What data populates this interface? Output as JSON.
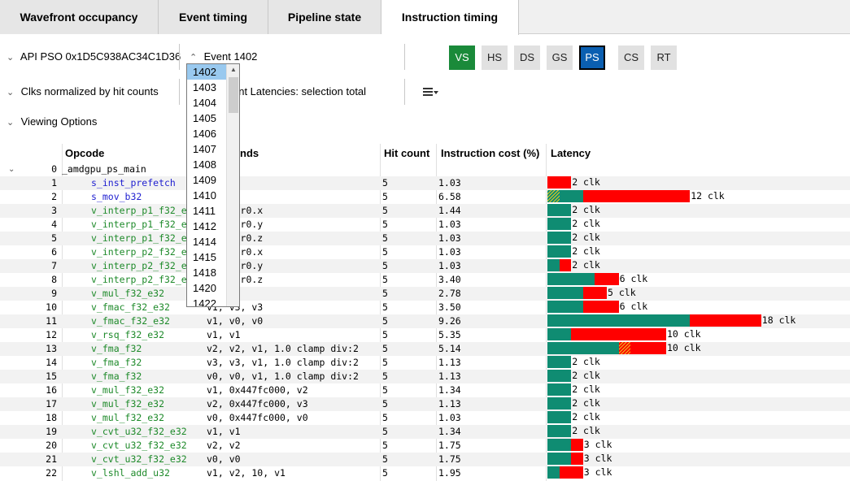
{
  "tabs": [
    {
      "label": "Wavefront occupancy",
      "active": false
    },
    {
      "label": "Event timing",
      "active": false
    },
    {
      "label": "Pipeline state",
      "active": false
    },
    {
      "label": "Instruction timing",
      "active": true
    }
  ],
  "toolbar": {
    "api_pso": "API PSO 0x1D5C938AC34C1D36",
    "event": "Event 1402",
    "clks_mode": "Clks normalized by hit counts",
    "latency_mode": "ont Latencies: selection total",
    "viewing_options": "Viewing Options",
    "stages": [
      "VS",
      "HS",
      "DS",
      "GS",
      "PS",
      "CS",
      "RT"
    ],
    "active_stages": [
      "VS",
      "PS"
    ]
  },
  "event_dropdown": {
    "selected": "1402",
    "options": [
      "1402",
      "1403",
      "1404",
      "1405",
      "1406",
      "1407",
      "1408",
      "1409",
      "1410",
      "1411",
      "1412",
      "1414",
      "1415",
      "1418",
      "1420",
      "1422"
    ]
  },
  "table": {
    "headers": {
      "opcode": "Opcode",
      "operands": "nds",
      "hit_count": "Hit count",
      "cost": "Instruction cost (%)",
      "latency": "Latency"
    },
    "function_index": "0",
    "function_name": "_amdgpu_ps_main",
    "rows": [
      {
        "idx": "1",
        "op": "s_inst_prefetch",
        "opnd": "",
        "hit": "5",
        "cost": "1.03",
        "total": 2,
        "teal": 0,
        "hatch": 0,
        "clk": "2 clk",
        "blue": true
      },
      {
        "idx": "2",
        "op": "s_mov_b32",
        "opnd": "25",
        "hit": "5",
        "cost": "6.58",
        "total": 12,
        "teal": 3,
        "hatch": 1,
        "clk": "12 clk",
        "blue": true
      },
      {
        "idx": "3",
        "op": "v_interp_p1_f32_e",
        "opnd": "), attr0.x",
        "hit": "5",
        "cost": "1.44",
        "total": 2,
        "teal": 2,
        "hatch": 0,
        "clk": "2 clk"
      },
      {
        "idx": "4",
        "op": "v_interp_p1_f32_e",
        "opnd": "), attr0.y",
        "hit": "5",
        "cost": "1.03",
        "total": 2,
        "teal": 2,
        "hatch": 0,
        "clk": "2 clk"
      },
      {
        "idx": "5",
        "op": "v_interp_p1_f32_e",
        "opnd": "), attr0.z",
        "hit": "5",
        "cost": "1.03",
        "total": 2,
        "teal": 2,
        "hatch": 0,
        "clk": "2 clk"
      },
      {
        "idx": "6",
        "op": "v_interp_p2_f32_e",
        "opnd": "., attr0.x",
        "hit": "5",
        "cost": "1.03",
        "total": 2,
        "teal": 2,
        "hatch": 0,
        "clk": "2 clk"
      },
      {
        "idx": "7",
        "op": "v_interp_p2_f32_e",
        "opnd": "., attr0.y",
        "hit": "5",
        "cost": "1.03",
        "total": 2,
        "teal": 1,
        "hatch": 0,
        "clk": "2 clk"
      },
      {
        "idx": "8",
        "op": "v_interp_p2_f32_e",
        "opnd": "., attr0.z",
        "hit": "5",
        "cost": "3.40",
        "total": 6,
        "teal": 4,
        "hatch": 0,
        "clk": "6 clk"
      },
      {
        "idx": "9",
        "op": "v_mul_f32_e32",
        "opnd": "v2, v2",
        "hit": "5",
        "cost": "2.78",
        "total": 5,
        "teal": 3,
        "hatch": 0,
        "clk": "5 clk"
      },
      {
        "idx": "10",
        "op": "v_fmac_f32_e32",
        "opnd": "v1, v3, v3",
        "hit": "5",
        "cost": "3.50",
        "total": 6,
        "teal": 3,
        "hatch": 0,
        "clk": "6 clk"
      },
      {
        "idx": "11",
        "op": "v_fmac_f32_e32",
        "opnd": "v1, v0, v0",
        "hit": "5",
        "cost": "9.26",
        "total": 18,
        "teal": 12,
        "hatch": 0,
        "clk": "18 clk"
      },
      {
        "idx": "12",
        "op": "v_rsq_f32_e32",
        "opnd": "v1, v1",
        "hit": "5",
        "cost": "5.35",
        "total": 10,
        "teal": 2,
        "hatch": 0,
        "clk": "10 clk"
      },
      {
        "idx": "13",
        "op": "v_fma_f32",
        "opnd": "v2, v2, v1, 1.0 clamp div:2",
        "hit": "5",
        "cost": "5.14",
        "total": 10,
        "teal": 6,
        "hatch": 1,
        "clk": "10 clk"
      },
      {
        "idx": "14",
        "op": "v_fma_f32",
        "opnd": "v3, v3, v1, 1.0 clamp div:2",
        "hit": "5",
        "cost": "1.13",
        "total": 2,
        "teal": 2,
        "hatch": 0,
        "clk": "2 clk"
      },
      {
        "idx": "15",
        "op": "v_fma_f32",
        "opnd": "v0, v0, v1, 1.0 clamp div:2",
        "hit": "5",
        "cost": "1.13",
        "total": 2,
        "teal": 2,
        "hatch": 0,
        "clk": "2 clk"
      },
      {
        "idx": "16",
        "op": "v_mul_f32_e32",
        "opnd": "v1, 0x447fc000, v2",
        "hit": "5",
        "cost": "1.34",
        "total": 2,
        "teal": 2,
        "hatch": 0,
        "clk": "2 clk"
      },
      {
        "idx": "17",
        "op": "v_mul_f32_e32",
        "opnd": "v2, 0x447fc000, v3",
        "hit": "5",
        "cost": "1.13",
        "total": 2,
        "teal": 2,
        "hatch": 0,
        "clk": "2 clk"
      },
      {
        "idx": "18",
        "op": "v_mul_f32_e32",
        "opnd": "v0, 0x447fc000, v0",
        "hit": "5",
        "cost": "1.03",
        "total": 2,
        "teal": 2,
        "hatch": 0,
        "clk": "2 clk"
      },
      {
        "idx": "19",
        "op": "v_cvt_u32_f32_e32",
        "opnd": "v1, v1",
        "hit": "5",
        "cost": "1.34",
        "total": 2,
        "teal": 2,
        "hatch": 0,
        "clk": "2 clk"
      },
      {
        "idx": "20",
        "op": "v_cvt_u32_f32_e32",
        "opnd": "v2, v2",
        "hit": "5",
        "cost": "1.75",
        "total": 3,
        "teal": 2,
        "hatch": 0,
        "clk": "3 clk"
      },
      {
        "idx": "21",
        "op": "v_cvt_u32_f32_e32",
        "opnd": "v0, v0",
        "hit": "5",
        "cost": "1.75",
        "total": 3,
        "teal": 2,
        "hatch": 0,
        "clk": "3 clk"
      },
      {
        "idx": "22",
        "op": "v_lshl_add_u32",
        "opnd": "v1, v2, 10, v1",
        "hit": "5",
        "cost": "1.95",
        "total": 3,
        "teal": 1,
        "hatch": 0,
        "clk": "3 clk"
      }
    ]
  },
  "colors": {
    "latency_teal": "#0f8c72",
    "latency_red": "#ff0000",
    "vs_active": "#1a8a3a",
    "ps_active": "#0b5fb1"
  }
}
